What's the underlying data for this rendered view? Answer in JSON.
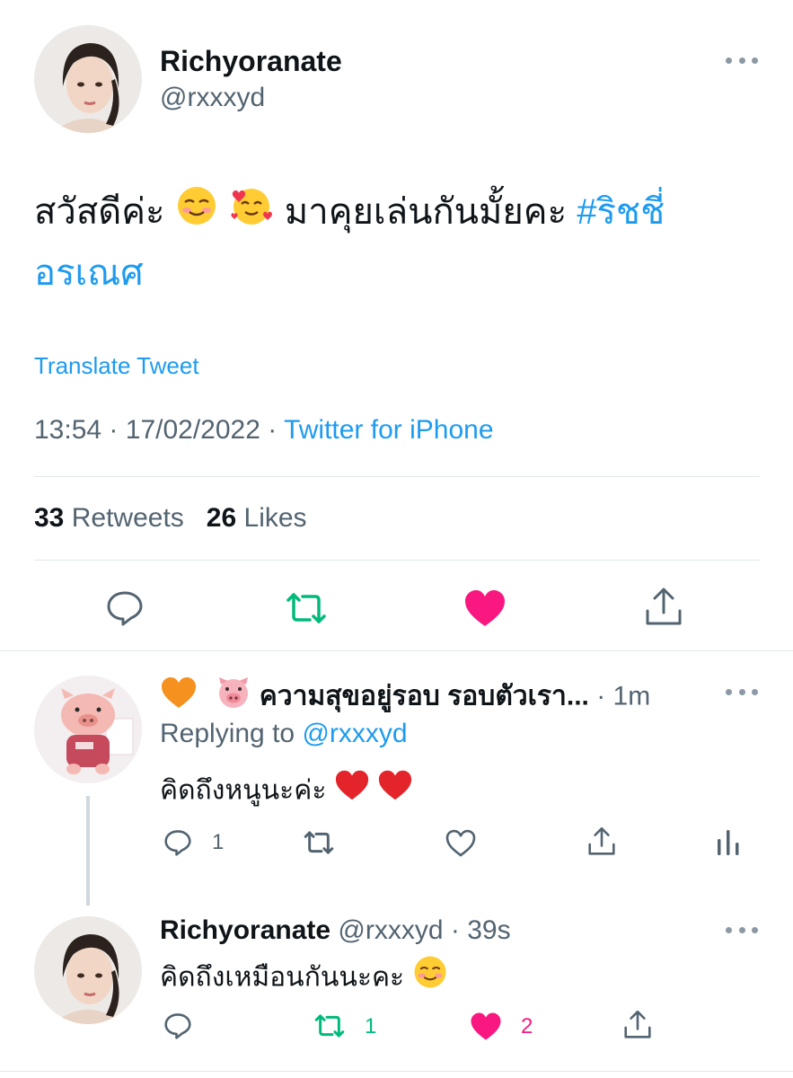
{
  "main_tweet": {
    "display_name": "Richyoranate",
    "handle": "@rxxxyd",
    "text_before": "สวัสดีค่ะ",
    "text_middle": "มาคุยเล่นกันมั้ยคะ",
    "hashtag_line1": "#ริชชี่",
    "hashtag_line2": "อรเณศ",
    "translate_label": "Translate Tweet",
    "time": "13:54",
    "date": "17/02/2022",
    "separator": "·",
    "source": "Twitter for iPhone",
    "retweets_count": "33",
    "retweets_label": "Retweets",
    "likes_count": "26",
    "likes_label": "Likes",
    "liked": true
  },
  "reply_1": {
    "display_name": "ความสุขอยู่รอบ รอบตัวเรา...",
    "time": "1m",
    "replying_label": "Replying to",
    "replying_handle": "@rxxxyd",
    "text": "คิดถึงหนูนะค่ะ",
    "reply_count": "1"
  },
  "reply_2": {
    "display_name": "Richyoranate",
    "handle_time": "@rxxxyd · 39s",
    "text": "คิดถึงเหมือนกันนะคะ",
    "retweet_count": "1",
    "like_count": "2"
  },
  "colors": {
    "link": "#1d9bf0",
    "muted": "#536471",
    "retweet_green": "#00ba7c",
    "like_pink": "#f91880"
  }
}
